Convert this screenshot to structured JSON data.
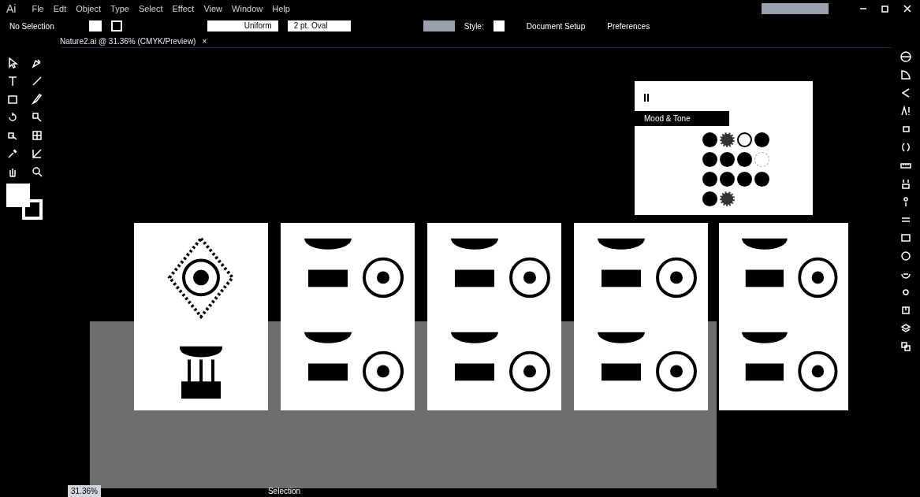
{
  "app_logo": "Ai",
  "menu": [
    "Fle",
    "Edt",
    "Object",
    "Type",
    "Select",
    "Effect",
    "View",
    "Window",
    "Help"
  ],
  "control_bar": {
    "selection": "No Selection",
    "stroke_profile": "Uniform",
    "brush": "2 pt. Oval",
    "style_label": "Style:",
    "buttons": [
      "Document Setup",
      "Preferences"
    ]
  },
  "document_tab": {
    "title": "Nature2.ai @ 31.36% (CMYK/Preview)",
    "close": "×"
  },
  "swatch_panel": {
    "group": "Mood & Tone",
    "rows": [
      {
        "swatches": [
          {
            "kind": "solid"
          },
          {
            "kind": "pattern"
          },
          {
            "kind": "light"
          },
          {
            "kind": "solid"
          }
        ]
      },
      {
        "swatches": [
          {
            "kind": "solid"
          },
          {
            "kind": "solid"
          },
          {
            "kind": "solid"
          },
          {
            "kind": "empty"
          }
        ]
      },
      {
        "swatches": [
          {
            "kind": "solid"
          },
          {
            "kind": "solid"
          },
          {
            "kind": "solid"
          },
          {
            "kind": "solid"
          }
        ]
      },
      {
        "swatches": [
          {
            "kind": "solid"
          },
          {
            "kind": "pattern"
          }
        ]
      }
    ]
  },
  "status_bar": {
    "zoom": "31.36%",
    "tool": "Selection"
  }
}
